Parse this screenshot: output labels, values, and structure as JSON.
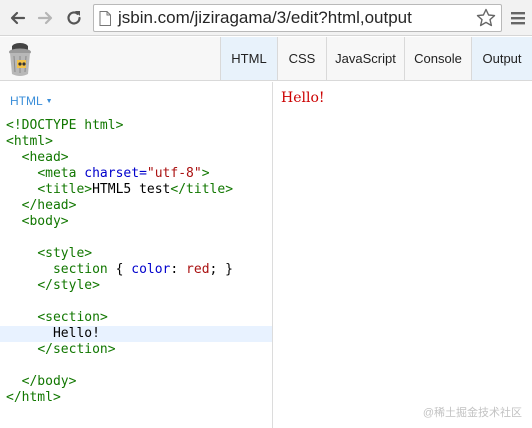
{
  "browser": {
    "url": "jsbin.com/jiziragama/3/edit?html,output"
  },
  "toolbar": {
    "tabs": [
      {
        "label": "HTML",
        "active": true
      },
      {
        "label": "CSS",
        "active": false
      },
      {
        "label": "JavaScript",
        "active": false
      },
      {
        "label": "Console",
        "active": false
      },
      {
        "label": "Output",
        "active": true
      }
    ]
  },
  "editor": {
    "panel_label": "HTML",
    "lines": [
      "<!DOCTYPE html>",
      "<html>",
      "  <head>",
      "    <meta charset=\"utf-8\">",
      "    <title>HTML5 test</title>",
      "  </head>",
      "  <body>",
      "",
      "    <style>",
      "      section { color: red; }",
      "    </style>",
      "",
      "    <section>",
      "      Hello!",
      "    </section>",
      "",
      "  </body>",
      "</html>"
    ]
  },
  "output": {
    "text": "Hello!",
    "color": "#cc0000"
  },
  "watermark": "@稀土掘金技术社区",
  "colors": {
    "accent": "#3a8ed9",
    "active_tab": "#e8f2fb",
    "active_line": "#e8f2ff"
  }
}
